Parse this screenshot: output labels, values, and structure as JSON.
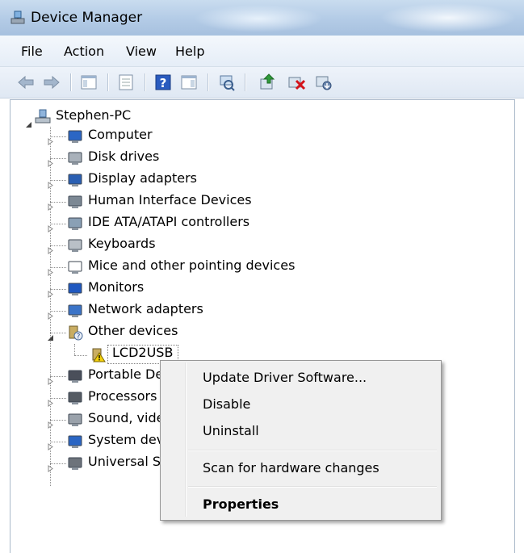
{
  "window": {
    "title": "Device Manager"
  },
  "menu": {
    "file": "File",
    "action": "Action",
    "view": "View",
    "help": "Help"
  },
  "toolbar": {
    "buttons": [
      "back-icon",
      "forward-icon",
      "show-hide-console-tree-icon",
      "properties-icon",
      "help-icon",
      "action-pane-icon",
      "scan-hardware-icon",
      "update-driver-icon",
      "disable-device-icon",
      "uninstall-device-icon"
    ]
  },
  "tree": {
    "root": "Stephen-PC",
    "items": [
      {
        "label": "Computer"
      },
      {
        "label": "Disk drives"
      },
      {
        "label": "Display adapters"
      },
      {
        "label": "Human Interface Devices"
      },
      {
        "label": "IDE ATA/ATAPI controllers"
      },
      {
        "label": "Keyboards"
      },
      {
        "label": "Mice and other pointing devices"
      },
      {
        "label": "Monitors"
      },
      {
        "label": "Network adapters"
      },
      {
        "label": "Other devices"
      },
      {
        "label": "LCD2USB"
      },
      {
        "label": "Portable De"
      },
      {
        "label": "Processors"
      },
      {
        "label": "Sound, vide"
      },
      {
        "label": "System dev"
      },
      {
        "label": "Universal S"
      }
    ]
  },
  "context_menu": {
    "update": "Update Driver Software...",
    "disable": "Disable",
    "uninstall": "Uninstall",
    "scan": "Scan for hardware changes",
    "properties": "Properties"
  }
}
